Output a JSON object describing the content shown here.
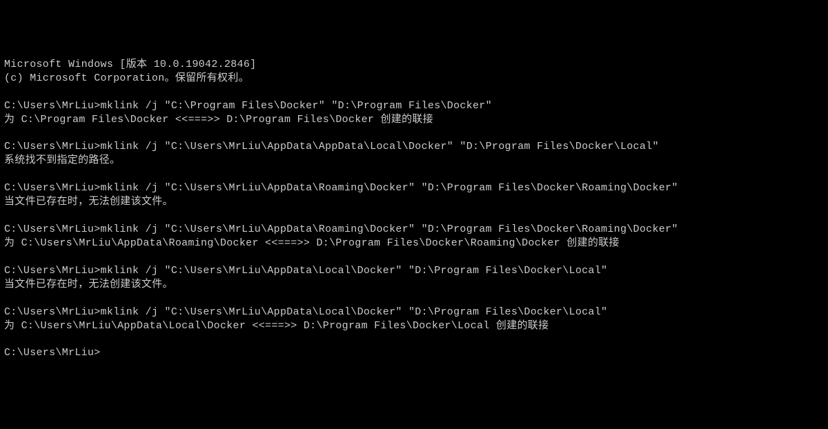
{
  "terminal": {
    "lines": [
      "Microsoft Windows [版本 10.0.19042.2846]",
      "(c) Microsoft Corporation。保留所有权利。",
      "",
      "C:\\Users\\MrLiu>mklink /j \"C:\\Program Files\\Docker\" \"D:\\Program Files\\Docker\"",
      "为 C:\\Program Files\\Docker <<===>> D:\\Program Files\\Docker 创建的联接",
      "",
      "C:\\Users\\MrLiu>mklink /j \"C:\\Users\\MrLiu\\AppData\\AppData\\Local\\Docker\" \"D:\\Program Files\\Docker\\Local\"",
      "系统找不到指定的路径。",
      "",
      "C:\\Users\\MrLiu>mklink /j \"C:\\Users\\MrLiu\\AppData\\Roaming\\Docker\" \"D:\\Program Files\\Docker\\Roaming\\Docker\"",
      "当文件已存在时，无法创建该文件。",
      "",
      "C:\\Users\\MrLiu>mklink /j \"C:\\Users\\MrLiu\\AppData\\Roaming\\Docker\" \"D:\\Program Files\\Docker\\Roaming\\Docker\"",
      "为 C:\\Users\\MrLiu\\AppData\\Roaming\\Docker <<===>> D:\\Program Files\\Docker\\Roaming\\Docker 创建的联接",
      "",
      "C:\\Users\\MrLiu>mklink /j \"C:\\Users\\MrLiu\\AppData\\Local\\Docker\" \"D:\\Program Files\\Docker\\Local\"",
      "当文件已存在时，无法创建该文件。",
      "",
      "C:\\Users\\MrLiu>mklink /j \"C:\\Users\\MrLiu\\AppData\\Local\\Docker\" \"D:\\Program Files\\Docker\\Local\"",
      "为 C:\\Users\\MrLiu\\AppData\\Local\\Docker <<===>> D:\\Program Files\\Docker\\Local 创建的联接",
      "",
      "C:\\Users\\MrLiu>"
    ]
  }
}
